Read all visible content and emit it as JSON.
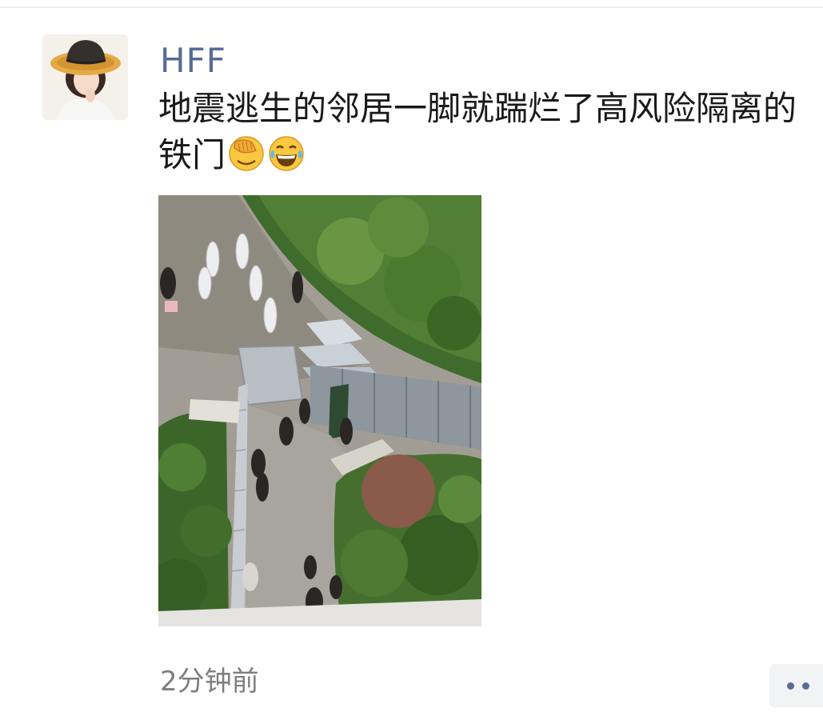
{
  "post": {
    "username": "HFF",
    "text": "地震逃生的邻居一脚就踹烂了高风险隔离的铁门",
    "emojis": [
      "facepalm-emoji",
      "tears-of-joy-emoji"
    ],
    "timestamp": "2分钟前"
  },
  "icons": {
    "more": "more-dots-icon"
  },
  "colors": {
    "username": "#576b95",
    "text": "#1a1a1a",
    "timestamp": "#7e7e7e",
    "more_button_bg": "#f2f3f5"
  }
}
